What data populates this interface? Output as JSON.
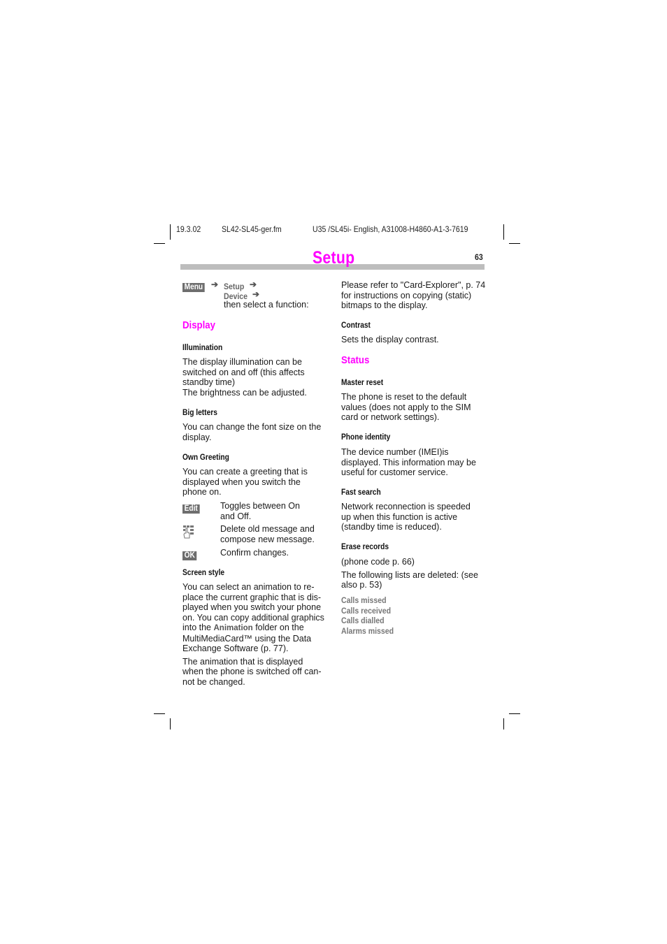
{
  "header": {
    "date": "19.3.02",
    "filename": "SL42-SL45-ger.fm",
    "doc_id": "U35 /SL45i- English, A31008-H4860-A1-3-7619"
  },
  "page": {
    "title": "Setup",
    "number": "63"
  },
  "nav": {
    "menu_key": "Menu",
    "path_1": "Setup",
    "path_2": "Device",
    "instruction": "then select a function:"
  },
  "left": {
    "display_heading": "Display",
    "illumination": {
      "heading": "Illumination",
      "text_1": "The display illumination can be",
      "text_2": "switched on and off (this affects",
      "text_3": "standby time)",
      "text_4": "The brightness can be adjusted."
    },
    "big_letters": {
      "heading": "Big letters",
      "text_1": "You can change the font size on the",
      "text_2": "display."
    },
    "own_greeting": {
      "heading": "Own Greeting",
      "text_1": "You can create a greeting that is",
      "text_2": "displayed when you switch the",
      "text_3": "phone on.",
      "actions": [
        {
          "key": "Edit",
          "line_1": "Toggles between On",
          "line_2": "and Off."
        },
        {
          "icon": "keypad-hand-icon",
          "line_1": "Delete old message and",
          "line_2": "compose new message."
        },
        {
          "key": "OK",
          "line_1": "Confirm changes."
        }
      ]
    },
    "screen_style": {
      "heading": "Screen style",
      "lines": [
        "You can select an  animation to re-",
        "place the current graphic that is dis-",
        "played when you switch your phone",
        "on. You can copy additional graphics"
      ],
      "line5_pre": "into the ",
      "line5_term": "Animation",
      "line5_post": " folder on the",
      "line6": "MultiMediaCard™ using the Data",
      "line7": "Exchange Software (p. 77).",
      "para2": [
        "The animation that is displayed",
        "when the phone is switched off can-",
        "not be changed."
      ]
    }
  },
  "right": {
    "intro": [
      "Please refer to \"Card-Explorer\", p. 74",
      "for instructions on copying (static)",
      "bitmaps to the display."
    ],
    "contrast": {
      "heading": "Contrast",
      "text": "Sets the display contrast."
    },
    "status_heading": "Status",
    "master_reset": {
      "heading": "Master reset",
      "lines": [
        "The phone is reset to the default",
        "values (does not apply to the SIM",
        "card or network settings)."
      ]
    },
    "phone_identity": {
      "heading": "Phone identity",
      "lines": [
        "The device number (IMEI)is",
        "displayed. This information may be",
        "useful for customer service."
      ]
    },
    "fast_search": {
      "heading": "Fast search",
      "lines": [
        "Network reconnection is speeded",
        "up when this function is active",
        "(standby time is reduced)."
      ]
    },
    "erase_records": {
      "heading": "Erase records",
      "code_note": "(phone code p. 66)",
      "lines": [
        "The following lists are deleted: (see",
        "also p. 53)"
      ],
      "lists": [
        "Calls missed",
        "Calls received",
        "Calls dialled",
        "Alarms missed"
      ]
    }
  },
  "colors": {
    "accent": "#ff00ff",
    "bar": "#bdbdbd",
    "key_bg": "#6e6e6e"
  }
}
